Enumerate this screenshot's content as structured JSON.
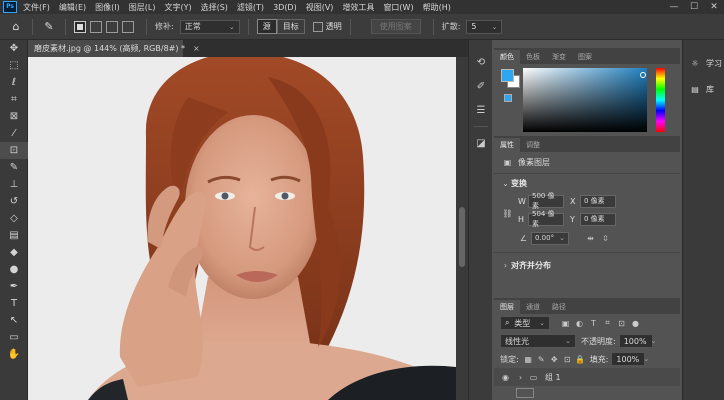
{
  "app": {
    "logo": "Ps"
  },
  "menu": [
    "文件(F)",
    "编辑(E)",
    "图像(I)",
    "图层(L)",
    "文字(Y)",
    "选择(S)",
    "滤镜(T)",
    "3D(D)",
    "视图(V)",
    "增效工具",
    "窗口(W)",
    "帮助(H)"
  ],
  "window_controls": {
    "minimize": "—",
    "maximize": "☐",
    "close": "✕"
  },
  "options": {
    "feather_label": "修补:",
    "mode_value": "正常",
    "source_label": "源",
    "destination_label": "目标",
    "transparent_label": "透明",
    "use_pattern_label": "使用图案",
    "diffusion_label": "扩散:",
    "diffusion_value": "5"
  },
  "document": {
    "tab_title": "磨皮素材.jpg @ 144% (高频, RGB/8#) *",
    "close": "×"
  },
  "tools": [
    "move-icon",
    "marquee-icon",
    "lasso-icon",
    "crop-icon",
    "frame-icon",
    "eyedropper-icon",
    "patch-icon",
    "brush-icon",
    "stamp-icon",
    "history-brush-icon",
    "eraser-icon",
    "gradient-icon",
    "blur-icon",
    "dodge-icon",
    "pen-icon",
    "type-icon",
    "path-select-icon",
    "shape-icon",
    "hand-icon"
  ],
  "color_panel": {
    "tabs": [
      "颜色",
      "色板",
      "渐变",
      "图案"
    ],
    "fg_color": "#2fa6f0",
    "bg_color": "#ffffff"
  },
  "properties": {
    "tabs": [
      "属性",
      "调整"
    ],
    "layer_type": "像素图层",
    "transform_title": "变换",
    "w_label": "W",
    "w_value": "500 像素",
    "h_label": "H",
    "h_value": "504 像素",
    "x_label": "X",
    "x_value": "0 像素",
    "y_label": "Y",
    "y_value": "0 像素",
    "angle_value": "0.00°",
    "align_title": "对齐并分布"
  },
  "layers": {
    "tabs": [
      "图层",
      "通道",
      "路径"
    ],
    "filter_value": "类型",
    "blend_mode": "线性光",
    "opacity_label": "不透明度:",
    "opacity_value": "100%",
    "lock_label": "锁定:",
    "fill_label": "填充:",
    "fill_value": "100%",
    "group_name": "组 1"
  },
  "right_rail": [
    {
      "icon": "lightbulb-icon",
      "label": "学习"
    },
    {
      "icon": "library-icon",
      "label": "库"
    }
  ]
}
